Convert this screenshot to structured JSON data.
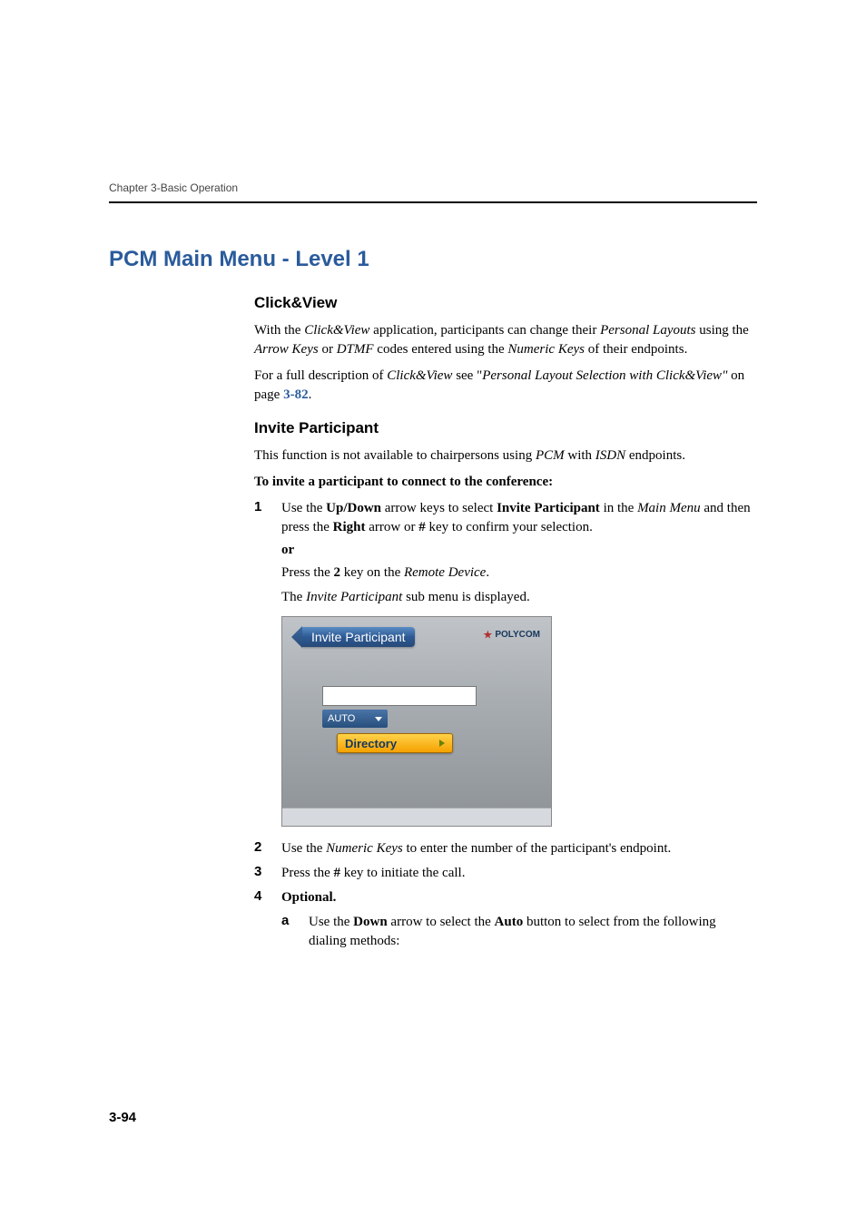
{
  "header": {
    "chapter": "Chapter 3-Basic Operation"
  },
  "h1": "PCM Main Menu - Level 1",
  "section1": {
    "title": "Click&View",
    "p1_a": "With the ",
    "p1_b": "Click&View",
    "p1_c": " application, participants can change their ",
    "p1_d": "Personal Layouts",
    "p1_e": " using the ",
    "p1_f": "Arrow Keys",
    "p1_g": " or ",
    "p1_h": "DTMF",
    "p1_i": " codes entered using the ",
    "p1_j": "Numeric Keys",
    "p1_k": " of their endpoints.",
    "p2_a": "For a full description of ",
    "p2_b": "Click&View",
    "p2_c": " see \"",
    "p2_d": "Personal Layout Selection with Click&View\"",
    "p2_e": " on page ",
    "p2_link": "3-82",
    "p2_f": "."
  },
  "section2": {
    "title": "Invite Participant",
    "intro_a": "This function is not available to chairpersons using ",
    "intro_b": "PCM",
    "intro_c": " with ",
    "intro_d": "ISDN",
    "intro_e": " endpoints.",
    "lead": "To invite a participant to connect to the conference:",
    "steps": {
      "s1": {
        "num": "1",
        "a": "Use the ",
        "b": "Up/Down",
        "c": " arrow keys to select ",
        "d": "Invite Participant",
        "e": " in the ",
        "f": "Main Menu",
        "g": " and then press the ",
        "h": "Right",
        "i": " arrow or ",
        "j": "#",
        "k": " key to confirm your selection."
      },
      "or": "or",
      "alt1_a": "Press the ",
      "alt1_b": "2",
      "alt1_c": " key on the ",
      "alt1_d": "Remote Device",
      "alt1_e": ".",
      "alt2_a": "The ",
      "alt2_b": "Invite Participant",
      "alt2_c": " sub menu is displayed.",
      "s2": {
        "num": "2",
        "a": "Use the ",
        "b": "Numeric Keys",
        "c": " to enter the number of the participant's endpoint."
      },
      "s3": {
        "num": "3",
        "a": "Press the ",
        "b": "#",
        "c": " key to initiate the call."
      },
      "s4": {
        "num": "4",
        "a": "Optional."
      },
      "sa": {
        "letter": "a",
        "a": "Use the ",
        "b": "Down",
        "c": " arrow to select the ",
        "d": "Auto",
        "e": " button to select from the following dialing methods:"
      }
    }
  },
  "screenshot": {
    "tab": "Invite Participant",
    "brand": "POLYCOM",
    "auto": "AUTO",
    "directory": "Directory"
  },
  "pagenum": "3-94"
}
